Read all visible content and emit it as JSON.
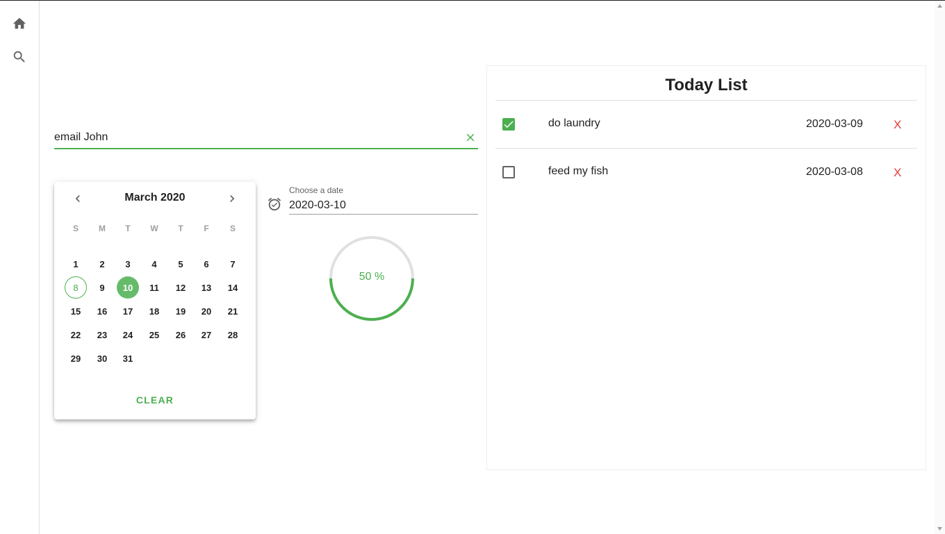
{
  "sidebar": {
    "items": [
      {
        "icon": "home-icon"
      },
      {
        "icon": "search-icon"
      }
    ]
  },
  "todo_input": {
    "value": "email John",
    "clear_icon": "close-icon"
  },
  "datepicker": {
    "month_label": "March 2020",
    "weekdays": [
      "S",
      "M",
      "T",
      "W",
      "T",
      "F",
      "S"
    ],
    "days": [
      "1",
      "2",
      "3",
      "4",
      "5",
      "6",
      "7",
      "8",
      "9",
      "10",
      "11",
      "12",
      "13",
      "14",
      "15",
      "16",
      "17",
      "18",
      "19",
      "20",
      "21",
      "22",
      "23",
      "24",
      "25",
      "26",
      "27",
      "28",
      "29",
      "30",
      "31"
    ],
    "first_weekday_index": 0,
    "today": "8",
    "selected": "10",
    "clear_label": "CLEAR"
  },
  "date_field": {
    "label": "Choose a date",
    "value": "2020-03-10",
    "icon": "alarm-icon"
  },
  "progress": {
    "value": 0.5,
    "label": "50 %"
  },
  "today_list": {
    "title": "Today List",
    "items": [
      {
        "text": "do laundry",
        "date": "2020-03-09",
        "checked": true,
        "delete_label": "X"
      },
      {
        "text": "feed my fish",
        "date": "2020-03-08",
        "checked": false,
        "delete_label": "X"
      }
    ]
  },
  "colors": {
    "accent": "#4caf50",
    "delete": "#e53935"
  }
}
